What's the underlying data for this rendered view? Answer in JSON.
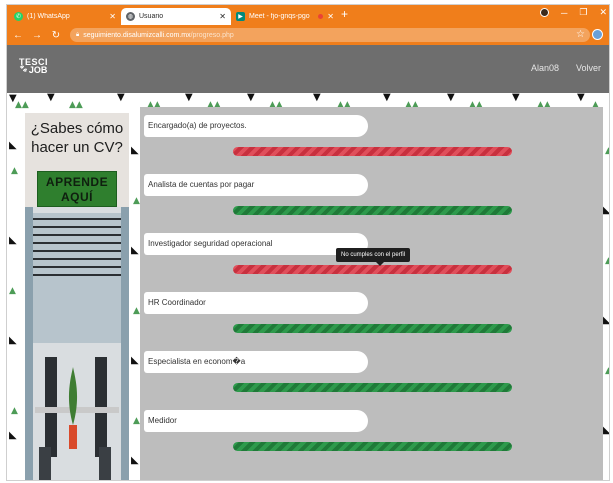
{
  "browser": {
    "tabs": [
      {
        "title": "(1) WhatsApp",
        "icon": "whatsapp-icon",
        "active": false
      },
      {
        "title": "Usuario",
        "icon": "globe-icon",
        "active": true
      },
      {
        "title": "Meet - fjo-gnqs-pgo",
        "icon": "meet-icon",
        "active": false
      }
    ],
    "new_tab": "+",
    "url_domain": "seguimiento.disalumizcalli.com.mx",
    "url_path": "/progreso.php",
    "accent_color": "#f07e1b"
  },
  "header": {
    "logo_top": "TESCI",
    "logo_bottom": "JOB",
    "user": "Alan08",
    "back": "Volver"
  },
  "banner": {
    "question": "¿Sabes cómo hacer un CV?",
    "cta": "Aprende aquí"
  },
  "jobs": [
    {
      "name": "Encargado(a) de proyectos.",
      "status": "no-match"
    },
    {
      "name": "Analista de cuentas por pagar",
      "status": "match"
    },
    {
      "name": "Investigador seguridad operacional",
      "status": "no-match"
    },
    {
      "name": "HR Coordinador",
      "status": "match"
    },
    {
      "name": "Especialista en econom�a",
      "status": "match"
    },
    {
      "name": "Medidor",
      "status": "match"
    }
  ],
  "tooltip": "No cumples con el perfil",
  "colors": {
    "match": "#2e9a4c",
    "no_match": "#e04f5b",
    "panel": "#bdbdbd",
    "header": "#6e6e6e"
  }
}
